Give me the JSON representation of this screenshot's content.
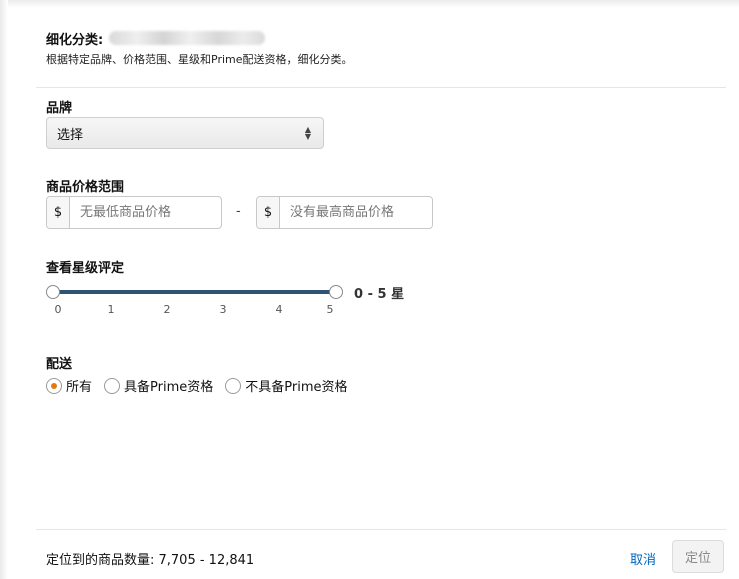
{
  "header": {
    "title": "细化分类:",
    "subtitle": "根据特定品牌、价格范围、星级和Prime配送资格，细化分类。"
  },
  "brand": {
    "label": "品牌",
    "selected": "选择",
    "arrows": "▲\n▼"
  },
  "price": {
    "label": "商品价格范围",
    "currency": "$",
    "min_placeholder": "无最低商品价格",
    "max_placeholder": "没有最高商品价格",
    "separator": "-"
  },
  "rating": {
    "label": "查看星级评定",
    "range_text": "0 - 5 星",
    "ticks": [
      "0",
      "1",
      "2",
      "3",
      "4",
      "5"
    ],
    "min": 0,
    "max": 5,
    "track_color": "#2f5375"
  },
  "shipping": {
    "label": "配送",
    "options": [
      "所有",
      "具备Prime资格",
      "不具备Prime资格"
    ],
    "selected_index": 0,
    "accent_color": "#e47911"
  },
  "footer": {
    "count_text": "定位到的商品数量: 7,705 - 12,841",
    "cancel_label": "取消",
    "confirm_label": "定位",
    "link_color": "#0066c0"
  }
}
